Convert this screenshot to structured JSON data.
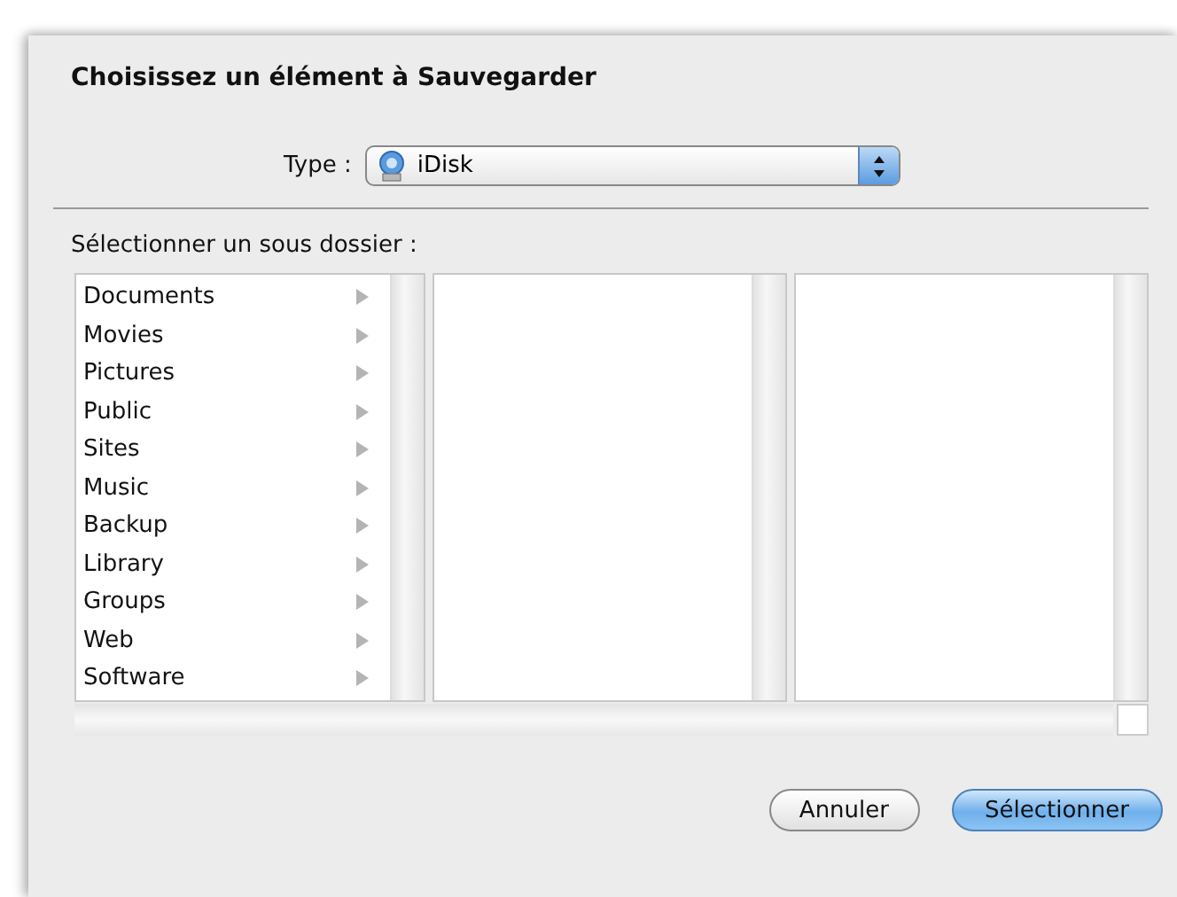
{
  "dialog": {
    "title": "Choisissez un élément à Sauvegarder"
  },
  "type_field": {
    "label": "Type :",
    "value": "iDisk"
  },
  "browser": {
    "label": "Sélectionner un sous dossier :",
    "columns": [
      {
        "items": [
          {
            "name": "Documents",
            "has_children": true
          },
          {
            "name": "Movies",
            "has_children": true
          },
          {
            "name": "Pictures",
            "has_children": true
          },
          {
            "name": "Public",
            "has_children": true
          },
          {
            "name": "Sites",
            "has_children": true
          },
          {
            "name": "Music",
            "has_children": true
          },
          {
            "name": "Backup",
            "has_children": true
          },
          {
            "name": "Library",
            "has_children": true
          },
          {
            "name": "Groups",
            "has_children": true
          },
          {
            "name": "Web",
            "has_children": true
          },
          {
            "name": "Software",
            "has_children": true
          }
        ]
      },
      {},
      {}
    ]
  },
  "buttons": [
    {
      "label": "Annuler",
      "kind": "cancel"
    },
    {
      "label": "Sélectionner",
      "kind": "default"
    }
  ]
}
